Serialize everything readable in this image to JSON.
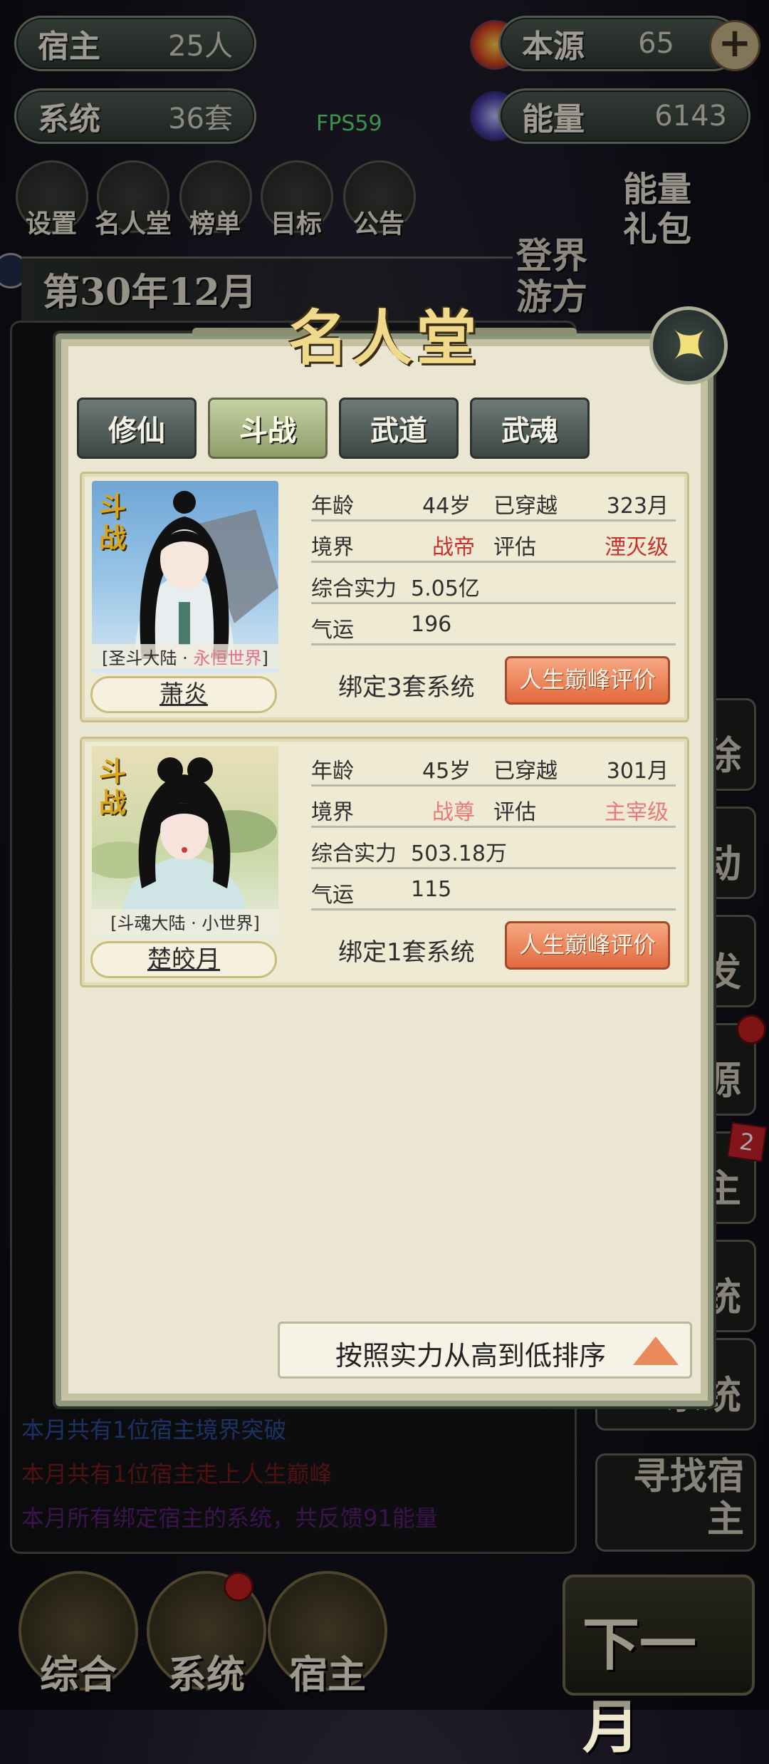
{
  "hud": {
    "host_label": "宿主",
    "host_value": "25人",
    "system_label": "系统",
    "system_value": "36套",
    "source_label": "本源",
    "source_value": "65",
    "plus": "+",
    "energy_label": "能量",
    "energy_value": "6143",
    "fps": "FPS59"
  },
  "menu": [
    "设置",
    "名人堂",
    "榜单",
    "目标",
    "公告"
  ],
  "energy_gift": "能量礼包",
  "date": "第30年12月",
  "travel": "登界游方",
  "log": {
    "line1": "本月共有1位宿主境界突破",
    "line2": "本月共有1位宿主走上人生巅峰",
    "line3": "本月所有绑定宿主的系统，共反馈91能量"
  },
  "side_buttons": [
    "除",
    "动",
    "发",
    "源",
    "主",
    "统",
    "系统",
    "寻找宿主"
  ],
  "side_badge": "2",
  "bottom_nav": [
    "综合",
    "系统",
    "宿主"
  ],
  "next_month": "下一月",
  "modal": {
    "title": "名人堂",
    "tabs": [
      "修仙",
      "斗战",
      "武道",
      "武魂"
    ],
    "active_tab": "斗战",
    "cards": [
      {
        "tag": "斗战",
        "world_prefix": "圣斗大陆 · ",
        "world_highlight": "永恒世界",
        "name": "萧炎",
        "age_label": "年龄",
        "age": "44岁",
        "crossed_label": "已穿越",
        "crossed": "323月",
        "realm_label": "境界",
        "realm": "战帝",
        "eval_label": "评估",
        "eval": "湮灭级",
        "power_label": "综合实力",
        "power": "5.05亿",
        "luck_label": "气运",
        "luck": "196",
        "bind": "绑定3套系统",
        "peak_button": "人生巅峰评价"
      },
      {
        "tag": "斗战",
        "world": "[斗魂大陆 · 小世界]",
        "name": "楚皎月",
        "age_label": "年龄",
        "age": "45岁",
        "crossed_label": "已穿越",
        "crossed": "301月",
        "realm_label": "境界",
        "realm": "战尊",
        "eval_label": "评估",
        "eval": "主宰级",
        "power_label": "综合实力",
        "power": "503.18万",
        "luck_label": "气运",
        "luck": "115",
        "bind": "绑定1套系统",
        "peak_button": "人生巅峰评价"
      }
    ],
    "sort_label": "按照实力从高到低排序"
  },
  "colors": {
    "realm_red": "#c8302c",
    "realm_pink": "#e87a7a",
    "peak_orange": "#e9763f",
    "title_gold": "#f0d98a"
  }
}
